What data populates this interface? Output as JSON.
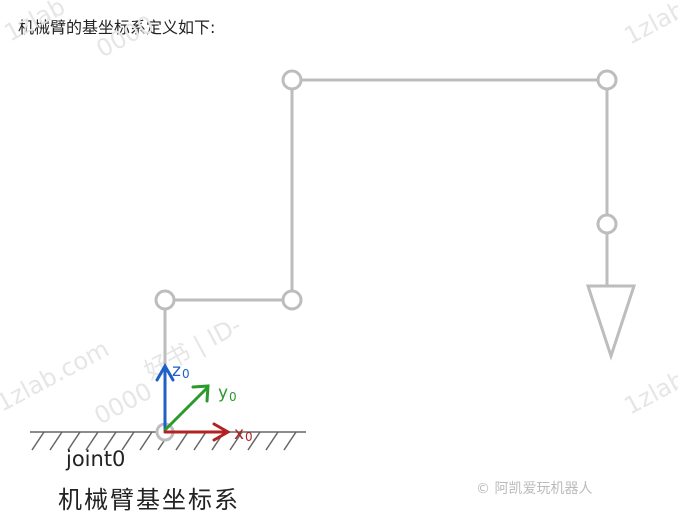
{
  "intro_text": "机械臂的基坐标系定义如下:",
  "axis_labels": {
    "z": "z",
    "z_sub": "0",
    "y": "y",
    "y_sub": "0",
    "x": "x",
    "x_sub": "0"
  },
  "joint_label": "joint0",
  "caption": "机械臂基坐标系",
  "credit": "© 阿凯爱玩机器人",
  "watermarks": [
    "1zlab.com",
    "1zlab",
    "1zlab",
    "1zlab",
    "0000",
    "0000",
    "好书 | ID-"
  ],
  "colors": {
    "arm": "#bdbdbd",
    "joint_fill": "#ffffff",
    "z_axis": "#1f5fc8",
    "y_axis": "#2a9a2a",
    "x_axis": "#b22222",
    "ground": "#666666",
    "watermark": "#e6e6e6",
    "text": "#222222",
    "credit": "#bbbbbb"
  }
}
